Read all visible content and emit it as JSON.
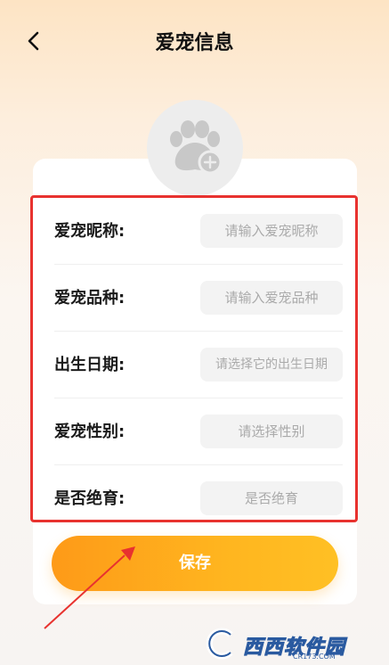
{
  "header": {
    "title": "爱宠信息"
  },
  "form": {
    "rows": [
      {
        "label": "爱宠昵称:",
        "placeholder": "请输入爱宠昵称"
      },
      {
        "label": "爱宠品种:",
        "placeholder": "请输入爱宠品种"
      },
      {
        "label": "出生日期:",
        "placeholder": "请选择它的出生日期"
      },
      {
        "label": "爱宠性别:",
        "placeholder": "请选择性别"
      },
      {
        "label": "是否绝育:",
        "placeholder": "是否绝育"
      }
    ]
  },
  "save_label": "保存",
  "watermark": {
    "brand": "西西软件园",
    "sub": "CR173.COM"
  },
  "colors": {
    "accent": "#ffb51f",
    "highlight": "#e8322f",
    "arrow": "#e8322f"
  }
}
